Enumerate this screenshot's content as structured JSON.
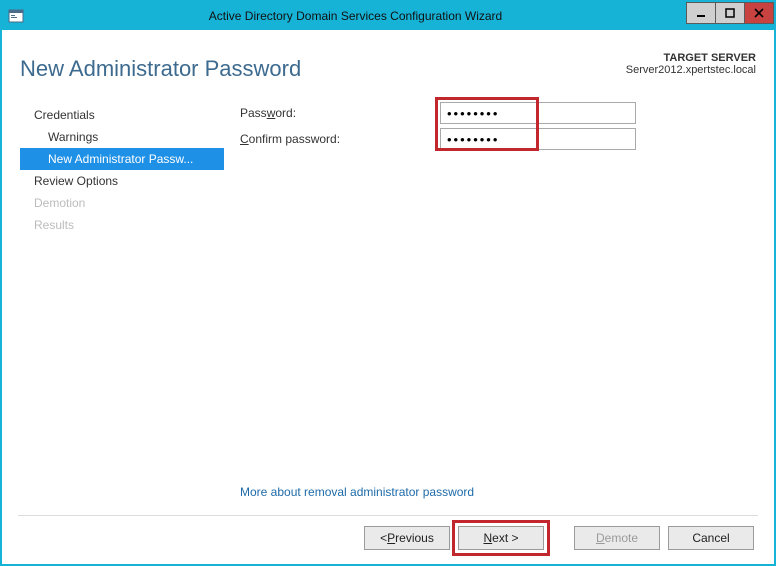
{
  "titlebar": {
    "title": "Active Directory Domain Services Configuration Wizard"
  },
  "header": {
    "page_title": "New Administrator Password",
    "target_label": "TARGET SERVER",
    "target_server": "Server2012.xpertstec.local"
  },
  "sidebar": {
    "items": [
      {
        "label": "Credentials"
      },
      {
        "label": "Warnings"
      },
      {
        "label": "New Administrator Passw..."
      },
      {
        "label": "Review Options"
      },
      {
        "label": "Demotion"
      },
      {
        "label": "Results"
      }
    ]
  },
  "form": {
    "password_label_pre": "Pass",
    "password_label_ul": "w",
    "password_label_post": "ord:",
    "confirm_label_pre": "",
    "confirm_label_ul": "C",
    "confirm_label_post": "onfirm password:",
    "password_value": "••••••••",
    "confirm_value": "••••••••",
    "more_link": "More about removal administrator password"
  },
  "buttons": {
    "previous_pre": "< ",
    "previous_ul": "P",
    "previous_post": "revious",
    "next_ul": "N",
    "next_post": "ext >",
    "demote_ul": "D",
    "demote_post": "emote",
    "cancel": "Cancel"
  }
}
